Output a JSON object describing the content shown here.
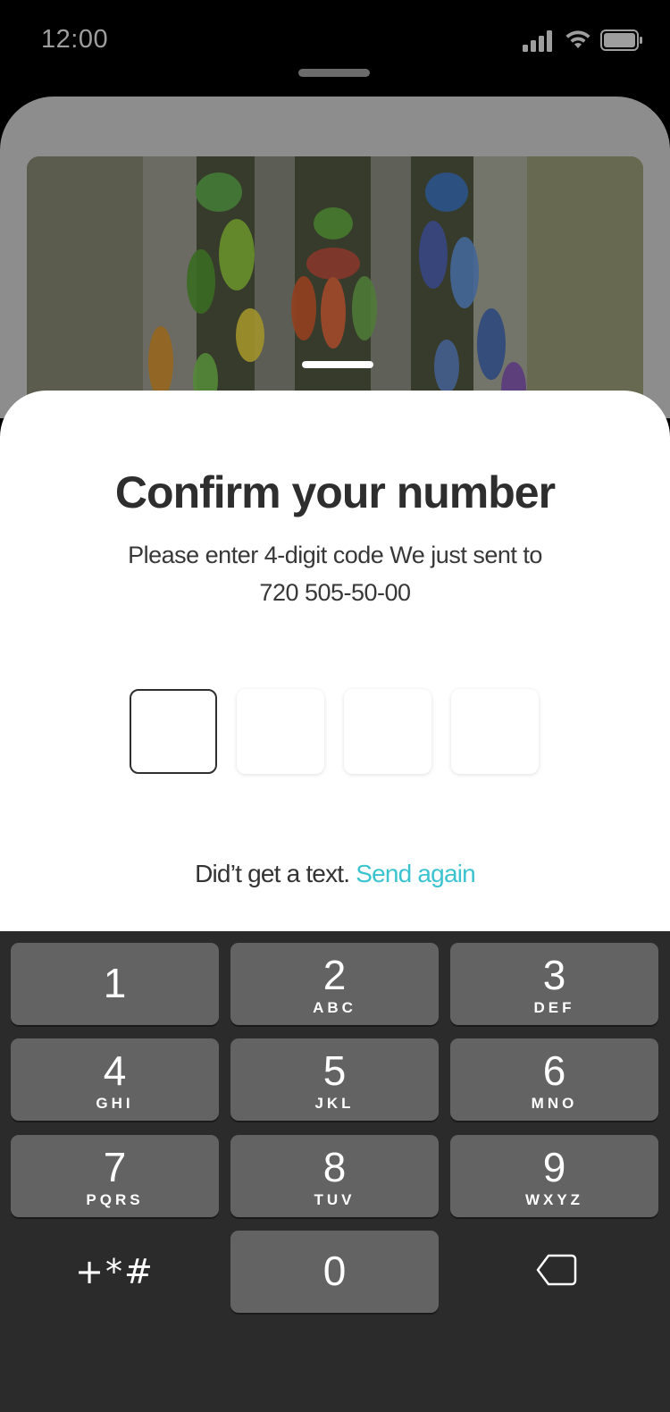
{
  "status_bar": {
    "time": "12:00"
  },
  "modal": {
    "title": "Confirm your number",
    "subtitle_line1": "Please enter 4-digit code We just sent to",
    "phone_number": "720 505-50-00",
    "code_digits": [
      "",
      "",
      "",
      ""
    ],
    "resend_prompt": "Did’t get a text.",
    "resend_link": "Send again"
  },
  "colors": {
    "accent": "#3cc3d0",
    "keypad_bg": "#2b2b2b",
    "key_bg": "#636363"
  },
  "keypad": {
    "keys": [
      {
        "number": "1",
        "letters": ""
      },
      {
        "number": "2",
        "letters": "ABC"
      },
      {
        "number": "3",
        "letters": "DEF"
      },
      {
        "number": "4",
        "letters": "GHI"
      },
      {
        "number": "5",
        "letters": "JKL"
      },
      {
        "number": "6",
        "letters": "MNO"
      },
      {
        "number": "7",
        "letters": "PQRS"
      },
      {
        "number": "8",
        "letters": "TUV"
      },
      {
        "number": "9",
        "letters": "WXYZ"
      },
      {
        "number": "0",
        "letters": ""
      }
    ],
    "symbols_label": "+*#",
    "delete_icon": "backspace-icon"
  },
  "icons": [
    "signal-icon",
    "wifi-icon",
    "battery-icon",
    "backspace-icon"
  ]
}
